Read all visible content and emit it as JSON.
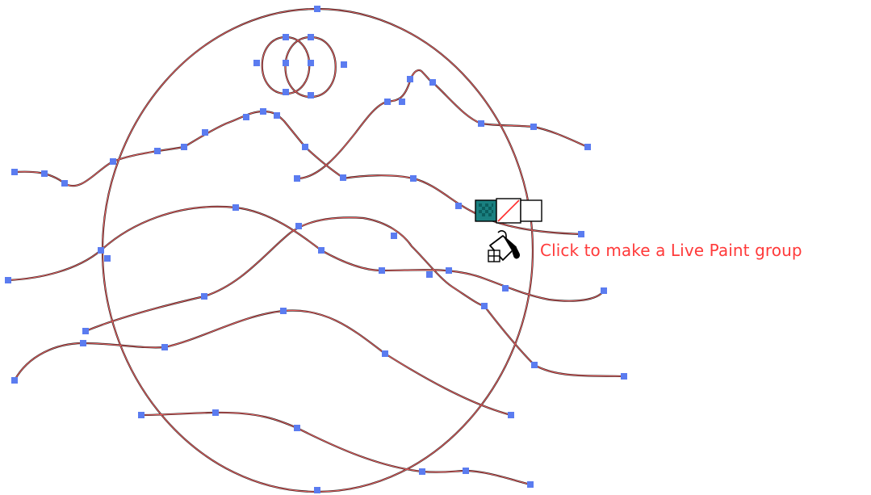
{
  "tooltip": {
    "text": "Click to make a Live Paint group"
  },
  "cursor": {
    "icon": "live-paint-bucket-icon",
    "swatches": [
      "fill-swatch-teal",
      "none-swatch",
      "empty-swatch-white"
    ]
  },
  "colors": {
    "path_outline": "#1a1a1a",
    "selection_highlight": "#f06060",
    "anchor_point": "#5b7cf0",
    "tooltip_text": "#ff3a3a",
    "fill_swatch": "#1a8080"
  }
}
